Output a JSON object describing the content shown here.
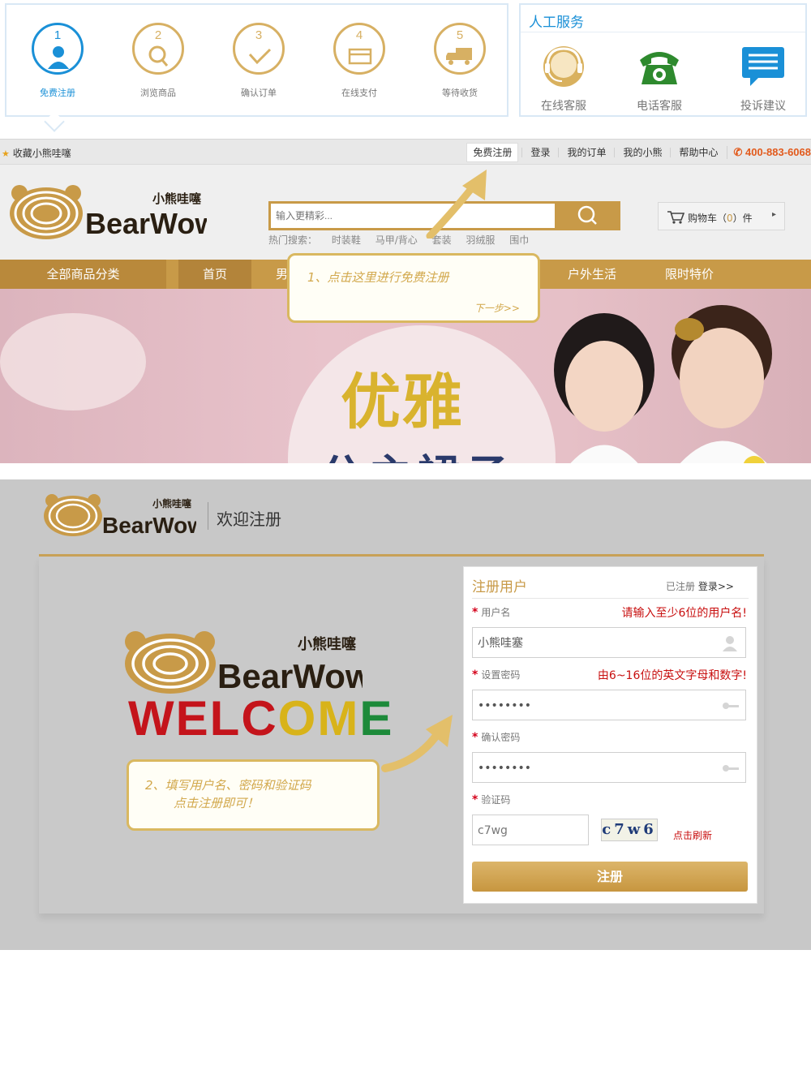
{
  "steps": {
    "items": [
      {
        "num": "1",
        "label": "免费注册",
        "icon": "user-icon",
        "active": true
      },
      {
        "num": "2",
        "label": "浏览商品",
        "icon": "magnifier-icon",
        "active": false
      },
      {
        "num": "3",
        "label": "确认订单",
        "icon": "check-icon",
        "active": false
      },
      {
        "num": "4",
        "label": "在线支付",
        "icon": "card-icon",
        "active": false
      },
      {
        "num": "5",
        "label": "等待收货",
        "icon": "truck-icon",
        "active": false
      }
    ]
  },
  "service": {
    "title": "人工服务",
    "items": [
      {
        "label": "在线客服",
        "icon": "headset-agent-icon"
      },
      {
        "label": "电话客服",
        "icon": "telephone-icon"
      },
      {
        "label": "投诉建议",
        "icon": "message-icon"
      }
    ]
  },
  "topbar": {
    "favorite": "收藏小熊哇噻",
    "links": [
      "免费注册",
      "登录",
      "我的订单",
      "我的小熊",
      "帮助中心"
    ],
    "hotline": "400-883-6068"
  },
  "logo": {
    "cn": "小熊哇噻",
    "en": "BearWow"
  },
  "search": {
    "placeholder": "输入更精彩...",
    "hot_label": "热门搜索：",
    "hot_words": [
      "时装鞋",
      "马甲/背心",
      "套装",
      "羽绒服",
      "围巾"
    ]
  },
  "cart": {
    "prefix": "购物车（",
    "count": "0",
    "suffix": "）件"
  },
  "nav": {
    "all": "全部商品分类",
    "items": [
      "首页",
      "男",
      "户外生活",
      "限时特价"
    ]
  },
  "banner": {
    "title": "优雅",
    "subtitle": "公主裙子"
  },
  "callout1": {
    "text": "1、点击这里进行免费注册",
    "next": "下一步>>"
  },
  "register": {
    "welcome_title": "欢迎注册",
    "welcome_word": "WELCOME",
    "form": {
      "title": "注册用户",
      "already": "已注册",
      "login_link": "登录>>",
      "username_label": "用户名",
      "username_hint": "请输入至少6位的用户名!",
      "username_value": "小熊哇塞",
      "password_label": "设置密码",
      "password_hint": "由6~16位的英文字母和数字!",
      "password_value": "••••••••",
      "confirm_label": "确认密码",
      "confirm_value": "••••••••",
      "captcha_label": "验证码",
      "captcha_value": "c7wg",
      "captcha_image_text": "c7w6",
      "refresh": "点击刷新",
      "submit": "注册"
    }
  },
  "callout2": {
    "line1": "2、填写用户名、密码和验证码",
    "line2": "点击注册即可！"
  },
  "colors": {
    "gold": "#c89a48",
    "blue": "#1a90d7",
    "red": "#c80f0f"
  }
}
